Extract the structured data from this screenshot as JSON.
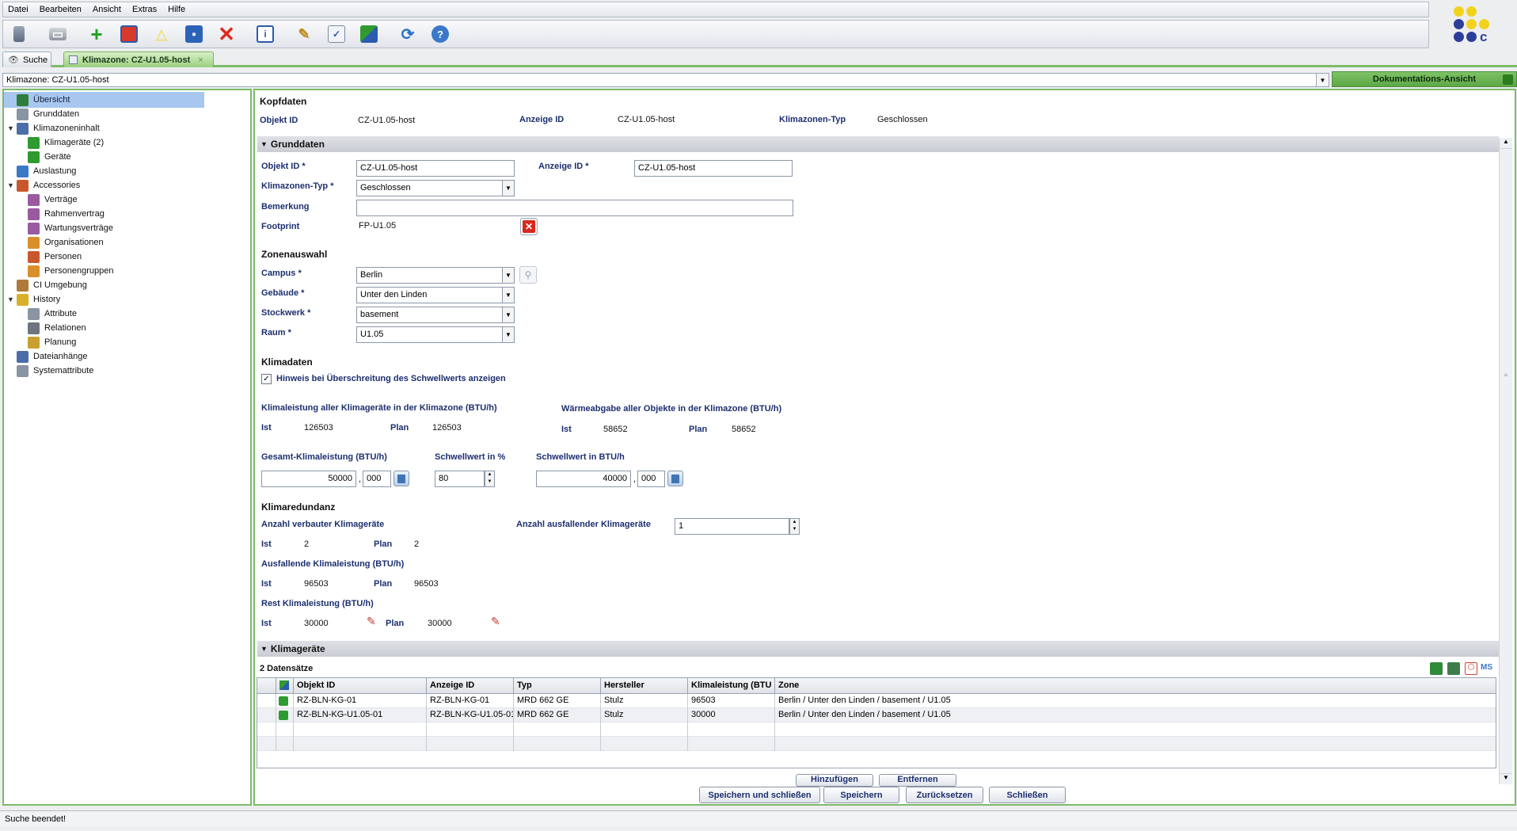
{
  "menu": [
    "Datei",
    "Bearbeiten",
    "Ansicht",
    "Extras",
    "Hilfe"
  ],
  "toolbar_icons": [
    "delete-doc-icon",
    "print-icon",
    "add-icon",
    "copy-icon",
    "warning-icon",
    "save-icon",
    "delete-icon",
    "info-icon",
    "tools-icon",
    "checklist-icon",
    "relations-icon",
    "refresh-icon",
    "help-icon"
  ],
  "tabs": [
    {
      "label": "Suche",
      "icon": "search-icon"
    },
    {
      "label": "Klimazone: CZ-U1.05-host",
      "icon": "climate-zone-icon"
    }
  ],
  "address": "Klimazone: CZ-U1.05-host",
  "doc_view": "Dokumentations-Ansicht",
  "tree": [
    {
      "label": "Übersicht",
      "icon": "overview-icon",
      "level": 0,
      "selected": true
    },
    {
      "label": "Grunddaten",
      "icon": "document-icon",
      "level": 0
    },
    {
      "label": "Klimazoneninhalt",
      "icon": "zone-icon",
      "level": 0,
      "expanded": true
    },
    {
      "label": "Klimageräte (2)",
      "icon": "ac-unit-icon",
      "level": 1
    },
    {
      "label": "Geräte",
      "icon": "device-icon",
      "level": 1
    },
    {
      "label": "Auslastung",
      "icon": "utilization-icon",
      "level": 0
    },
    {
      "label": "Accessories",
      "icon": "accessories-icon",
      "level": 0,
      "expanded": true
    },
    {
      "label": "Verträge",
      "icon": "contract-icon",
      "level": 1
    },
    {
      "label": "Rahmenvertrag",
      "icon": "contract-icon",
      "level": 1
    },
    {
      "label": "Wartungsverträge",
      "icon": "contract-icon",
      "level": 1
    },
    {
      "label": "Organisationen",
      "icon": "organization-icon",
      "level": 1
    },
    {
      "label": "Personen",
      "icon": "person-icon",
      "level": 1
    },
    {
      "label": "Personengruppen",
      "icon": "group-icon",
      "level": 1
    },
    {
      "label": "CI Umgebung",
      "icon": "ci-environment-icon",
      "level": 0
    },
    {
      "label": "History",
      "icon": "history-icon",
      "level": 0,
      "expanded": true
    },
    {
      "label": "Attribute",
      "icon": "document-icon",
      "level": 1
    },
    {
      "label": "Relationen",
      "icon": "relations-icon",
      "level": 1
    },
    {
      "label": "Planung",
      "icon": "planning-icon",
      "level": 1
    },
    {
      "label": "Dateianhänge",
      "icon": "attachment-icon",
      "level": 0
    },
    {
      "label": "Systemattribute",
      "icon": "document-icon",
      "level": 0
    }
  ],
  "kopfdaten": {
    "title": "Kopfdaten",
    "objekt_id_label": "Objekt ID",
    "objekt_id": "CZ-U1.05-host",
    "anzeige_id_label": "Anzeige ID",
    "anzeige_id": "CZ-U1.05-host",
    "typ_label": "Klimazonen-Typ",
    "typ": "Geschlossen"
  },
  "grunddaten": {
    "title": "Grunddaten",
    "objekt_id_label": "Objekt ID *",
    "objekt_id": "CZ-U1.05-host",
    "anzeige_id_label": "Anzeige ID *",
    "anzeige_id": "CZ-U1.05-host",
    "typ_label": "Klimazonen-Typ *",
    "typ": "Geschlossen",
    "bemerkung_label": "Bemerkung",
    "bemerkung": "",
    "footprint_label": "Footprint",
    "footprint": "FP-U1.05"
  },
  "zonenauswahl": {
    "title": "Zonenauswahl",
    "campus_label": "Campus *",
    "campus": "Berlin",
    "gebaeude_label": "Gebäude *",
    "gebaeude": "Unter den Linden",
    "stockwerk_label": "Stockwerk *",
    "stockwerk": "basement",
    "raum_label": "Raum *",
    "raum": "U1.05"
  },
  "klimadaten": {
    "title": "Klimadaten",
    "hinweis_label": "Hinweis bei Überschreitung des Schwellwerts anzeigen",
    "hinweis_checked": true,
    "klimaleistung_title": "Klimaleistung aller Klimageräte in der Klimazone (BTU/h)",
    "waermeabgabe_title": "Wärmeabgabe aller Objekte in der Klimazone (BTU/h)",
    "ist_label": "Ist",
    "plan_label": "Plan",
    "klima_ist": "126503",
    "klima_plan": "126503",
    "waerme_ist": "58652",
    "waerme_plan": "58652",
    "gesamt_label": "Gesamt-Klimaleistung (BTU/h)",
    "gesamt_int": "50000",
    "gesamt_dec": "000",
    "schwell_pct_label": "Schwellwert in %",
    "schwell_pct": "80",
    "schwell_btu_label": "Schwellwert in BTU/h",
    "schwell_btu_int": "40000",
    "schwell_btu_dec": "000",
    "decimal_sep": ","
  },
  "klimaredundanz": {
    "title": "Klimaredundanz",
    "verbaut_label": "Anzahl verbauter Klimageräte",
    "ausfallend_anzahl_label": "Anzahl ausfallender Klimageräte",
    "ausfallend_anzahl": "1",
    "ist_label": "Ist",
    "plan_label": "Plan",
    "verbaut_ist": "2",
    "verbaut_plan": "2",
    "ausfallend_leistung_label": "Ausfallende Klimaleistung (BTU/h)",
    "ausfallend_ist": "96503",
    "ausfallend_plan": "96503",
    "rest_label": "Rest Klimaleistung (BTU/h)",
    "rest_ist": "30000",
    "rest_plan": "30000"
  },
  "klimageraete": {
    "title": "Klimageräte",
    "count": "2 Datensätze",
    "export_icons": [
      "excel-export-icon",
      "csv-export-icon",
      "pdf-export-icon",
      "ms-export-icon"
    ],
    "export_ms_label": "MS",
    "columns": [
      "Objekt ID",
      "Anzeige ID",
      "Typ",
      "Hersteller",
      "Klimaleistung (BTU",
      "Zone"
    ],
    "rows": [
      [
        "RZ-BLN-KG-01",
        "RZ-BLN-KG-01",
        "MRD 662 GE",
        "Stulz",
        "96503",
        "Berlin / Unter den Linden / basement / U1.05"
      ],
      [
        "RZ-BLN-KG-U1.05-01",
        "RZ-BLN-KG-U1.05-01",
        "MRD 662 GE",
        "Stulz",
        "30000",
        "Berlin / Unter den Linden / basement / U1.05"
      ]
    ],
    "add_label": "Hinzufügen",
    "remove_label": "Entfernen"
  },
  "footer_buttons": {
    "save_close": "Speichern und schließen",
    "save": "Speichern",
    "reset": "Zurücksetzen",
    "close": "Schließen"
  },
  "status": "Suche beendet!",
  "colors": {
    "accent_green": "#7dbb69",
    "label_blue": "#1c2f6f",
    "selection": "#a7c7f0"
  }
}
